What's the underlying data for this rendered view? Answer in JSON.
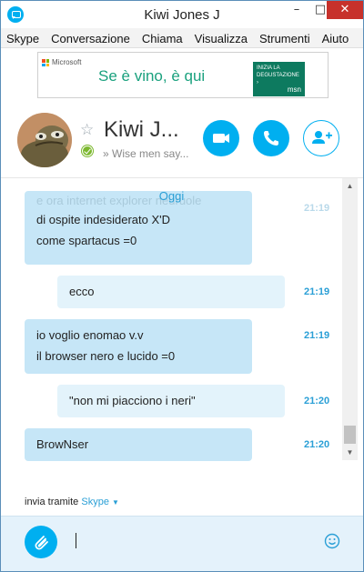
{
  "window": {
    "title": "Kiwi Jones J",
    "minimize": "–",
    "maximize": "□",
    "close": "✕"
  },
  "menu": [
    "Skype",
    "Conversazione",
    "Chiama",
    "Visualizza",
    "Strumenti",
    "Aiuto"
  ],
  "ad": {
    "brand": "Microsoft",
    "headline": "Se è vino, è qui",
    "cta_line1": "INIZIA LA",
    "cta_line2": "DEGUSTAZIONE ›",
    "cta_brand": "msn"
  },
  "contact": {
    "name": "Kiwi J...",
    "mood": "» Wise men say...",
    "status": "online",
    "icons": {
      "favorite": "star-icon",
      "status": "check-icon",
      "video": "video-icon",
      "call": "phone-icon",
      "add": "add-contact-icon"
    }
  },
  "conversation": {
    "day_label": "Oggi",
    "messages": [
      {
        "dir": "in",
        "lines": [
          "e ora internet explorer neuruole",
          "di ospite indesiderato X'D",
          "come spartacus =0"
        ],
        "time": "21:19"
      },
      {
        "dir": "out",
        "lines": [
          "ecco"
        ],
        "time": "21:19"
      },
      {
        "dir": "in",
        "lines": [
          "io voglio enomao v.v",
          "il browser nero e lucido =0"
        ],
        "time": "21:19"
      },
      {
        "dir": "out",
        "lines": [
          "\"non mi piacciono i neri\""
        ],
        "time": "21:20"
      },
      {
        "dir": "in",
        "lines": [
          "BrowNser"
        ],
        "time": "21:20"
      }
    ]
  },
  "via": {
    "label": "invia tramite",
    "service": "Skype"
  },
  "compose": {
    "value": "",
    "icons": {
      "attach": "paperclip-icon",
      "emoji": "emoticon-icon"
    }
  },
  "colors": {
    "accent": "#00aff0",
    "incoming_bubble": "#c6e6f7",
    "outgoing_bubble": "#e3f3fb",
    "timestamp": "#2a9fd6",
    "compose_bg": "#e4f2fb",
    "close_button": "#c7312b"
  }
}
